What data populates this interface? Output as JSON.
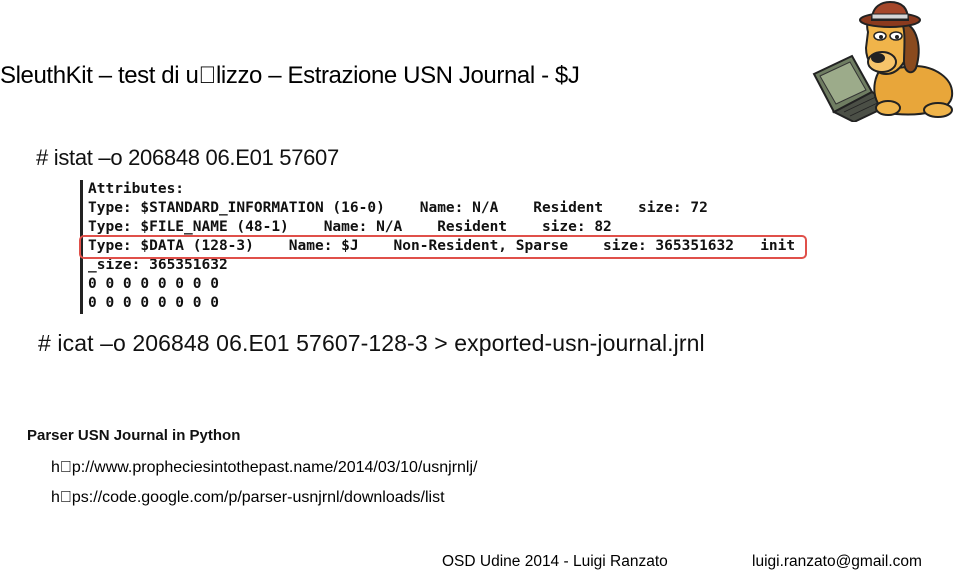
{
  "slide": {
    "title": "SleuthKit – test di u\u0000lizzo – Estrazione USN Journal - $J"
  },
  "commands": {
    "istat": "# istat –o 206848 06.E01 57607",
    "icat": "# icat –o 206848 06.E01 57607-128-3 > exported-usn-journal.jrnl"
  },
  "terminal": {
    "lines": [
      "Attributes:",
      "Type: $STANDARD_INFORMATION (16-0)    Name: N/A    Resident    size: 72",
      "Type: $FILE_NAME (48-1)    Name: N/A    Resident    size: 82",
      "Type: $DATA (128-3)    Name: $J    Non-Resident, Sparse    size: 365351632   init",
      "_size: 365351632",
      "0 0 0 0 0 0 0 0",
      "0 0 0 0 0 0 0 0"
    ]
  },
  "parser": {
    "title": "Parser USN Journal in Python",
    "links": [
      "h\u0000p://www.propheciesintothepast.name/2014/03/10/usnjrnlj/",
      "h\u0000ps://code.google.com/p/parser-usnjrnl/downloads/list"
    ]
  },
  "footer": {
    "event": "OSD Udine 2014  - Luigi Ranzato",
    "email": "luigi.ranzato@gmail.com"
  },
  "colors": {
    "highlight": "#e0504a"
  },
  "icons": {
    "mascot": "detective-hound-with-laptop"
  }
}
